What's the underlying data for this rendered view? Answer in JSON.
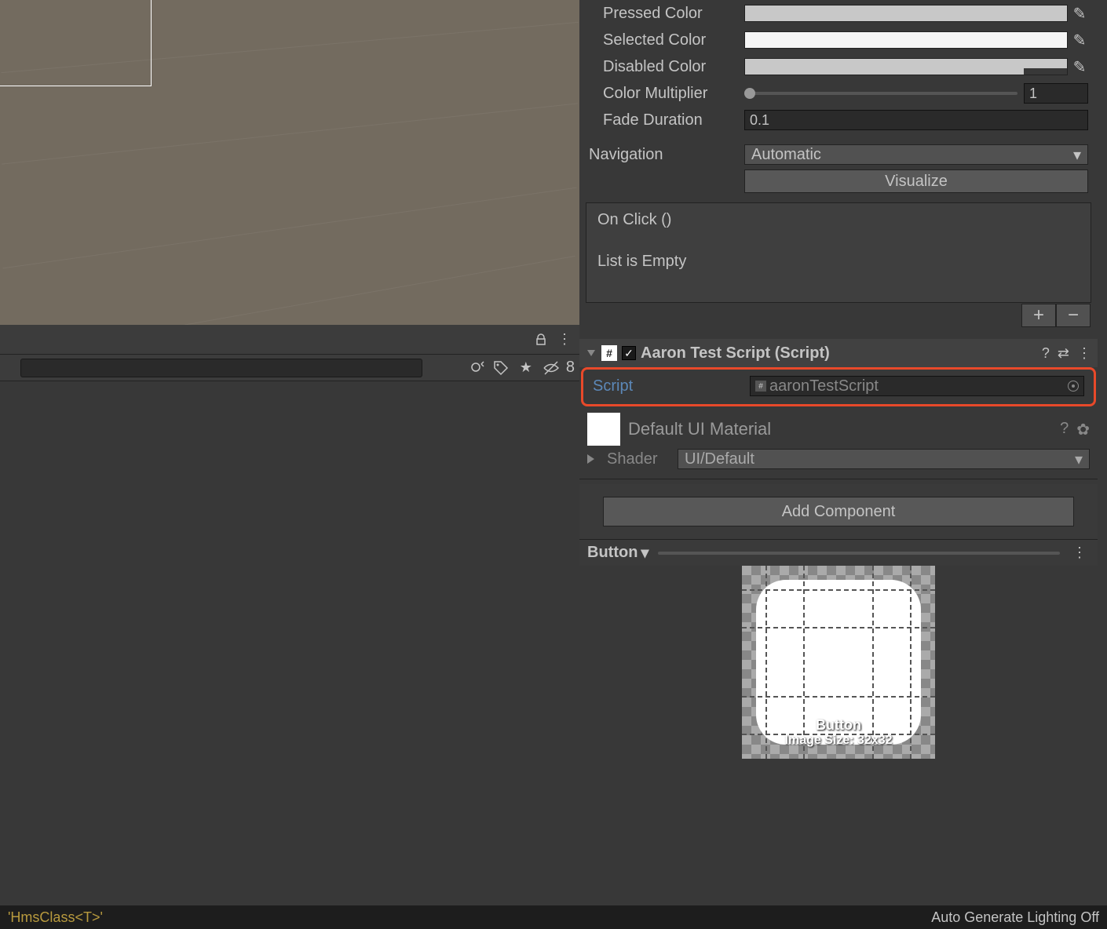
{
  "inspector": {
    "pressedColor": "Pressed Color",
    "selectedColor": "Selected Color",
    "disabledColor": "Disabled Color",
    "colorMultiplier": "Color Multiplier",
    "colorMultiplierValue": "1",
    "fadeDuration": "Fade Duration",
    "fadeDurationValue": "0.1",
    "navigation": "Navigation",
    "navigationValue": "Automatic",
    "visualize": "Visualize",
    "onClick": "On Click ()",
    "listEmpty": "List is Empty",
    "scriptComponent": "Aaron Test Script (Script)",
    "scriptLabel": "Script",
    "scriptValue": "aaronTestScript",
    "materialTitle": "Default UI Material",
    "shaderLabel": "Shader",
    "shaderValue": "UI/Default",
    "addComponent": "Add Component"
  },
  "preview": {
    "title": "Button",
    "imageLabel": "Button",
    "imageSize": "Image Size: 32x32"
  },
  "toolbar": {
    "hiddenCount": "8"
  },
  "status": {
    "error": "'HmsClass<T>'",
    "lighting": "Auto Generate Lighting Off"
  }
}
